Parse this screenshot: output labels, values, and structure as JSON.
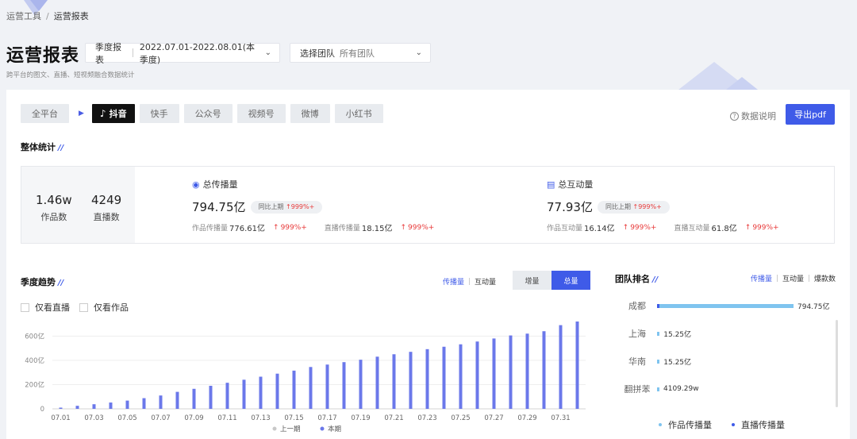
{
  "breadcrumb": {
    "parent": "运营工具",
    "separator": "/",
    "current": "运营报表"
  },
  "header": {
    "title": "运营报表",
    "subtitle": "跨平台的图文、直播、短视频融合数据统计",
    "period_select": {
      "label": "季度报表",
      "value": "2022.07.01-2022.08.01(本季度)"
    },
    "team_select": {
      "label": "选择团队",
      "value": "所有团队"
    }
  },
  "platform_tabs": [
    "全平台",
    "抖音",
    "快手",
    "公众号",
    "视频号",
    "微博",
    "小红书"
  ],
  "active_platform": "抖音",
  "help_label": "数据说明",
  "export_label": "导出pdf",
  "overall": {
    "title": "整体统计",
    "works_value": "1.46w",
    "works_label": "作品数",
    "live_value": "4249",
    "live_label": "直播数",
    "spread": {
      "title": "总传播量",
      "value": "794.75亿",
      "compare_label": "同比上期",
      "compare_value": "999%+",
      "work_label": "作品传播量",
      "work_value": "776.61亿",
      "work_up": "999%+",
      "live_label": "直播传播量",
      "live_value": "18.15亿",
      "live_up": "999%+"
    },
    "interact": {
      "title": "总互动量",
      "value": "77.93亿",
      "compare_label": "同比上期",
      "compare_value": "999%+",
      "work_label": "作品互动量",
      "work_value": "16.14亿",
      "work_up": "999%+",
      "live_label": "直播互动量",
      "live_value": "61.8亿",
      "live_up": "999%+"
    }
  },
  "trend": {
    "title": "季度趋势",
    "metric_on": "传播量",
    "metric_off": "互动量",
    "mode_a": "增量",
    "mode_b": "总量",
    "filter_live": "仅看直播",
    "filter_works": "仅看作品"
  },
  "chart_data": {
    "type": "bar",
    "categories": [
      "07.01",
      "07.02",
      "07.03",
      "07.04",
      "07.05",
      "07.06",
      "07.07",
      "07.08",
      "07.09",
      "07.10",
      "07.11",
      "07.12",
      "07.13",
      "07.14",
      "07.15",
      "07.16",
      "07.17",
      "07.18",
      "07.19",
      "07.20",
      "07.21",
      "07.22",
      "07.23",
      "07.24",
      "07.25",
      "07.26",
      "07.27",
      "07.28",
      "07.29",
      "07.30",
      "07.31",
      "08.01"
    ],
    "tick_labels": [
      "07.01",
      "07.03",
      "07.05",
      "07.07",
      "07.09",
      "07.11",
      "07.13",
      "07.15",
      "07.17",
      "07.19",
      "07.21",
      "07.23",
      "07.25",
      "07.27",
      "07.29",
      "07.31"
    ],
    "series": [
      {
        "name": "上一期",
        "color": "#c8c8c8",
        "values": [
          0,
          0,
          0,
          0,
          0,
          0,
          0,
          0,
          0,
          0,
          0,
          0,
          0,
          0,
          0,
          0,
          0,
          0,
          0,
          0,
          0,
          0,
          0,
          0,
          0,
          0,
          0,
          0,
          0,
          0,
          0,
          0
        ]
      },
      {
        "name": "本期",
        "color": "#6b78ea",
        "values": [
          10,
          25,
          38,
          52,
          68,
          88,
          110,
          140,
          165,
          190,
          215,
          240,
          265,
          290,
          315,
          345,
          365,
          385,
          405,
          430,
          450,
          470,
          492,
          512,
          532,
          555,
          580,
          605,
          620,
          640,
          690,
          720
        ]
      }
    ],
    "yticks": [
      "0",
      "200亿",
      "400亿",
      "600亿"
    ],
    "ylim": [
      0,
      720
    ],
    "grid": true,
    "legend": "bottom"
  },
  "team_rank": {
    "title": "团队排名",
    "tabs": [
      "传播量",
      "互动量",
      "爆款数"
    ],
    "rows": [
      {
        "name": "成都",
        "value": "794.75亿",
        "ratio": 1.0,
        "color": "#7fc4ef"
      },
      {
        "name": "上海",
        "value": "15.25亿",
        "ratio": 0.019,
        "color": "#7fc4ef"
      },
      {
        "name": "华南",
        "value": "15.25亿",
        "ratio": 0.019,
        "color": "#7fc4ef"
      },
      {
        "name": "翻拼苯",
        "value": "4109.29w",
        "ratio": 0.005,
        "color": "#7fc4ef"
      }
    ],
    "legend": [
      {
        "name": "作品传播量",
        "color": "#7fc4ef"
      },
      {
        "name": "直播传播量",
        "color": "#3f5be8"
      }
    ]
  }
}
